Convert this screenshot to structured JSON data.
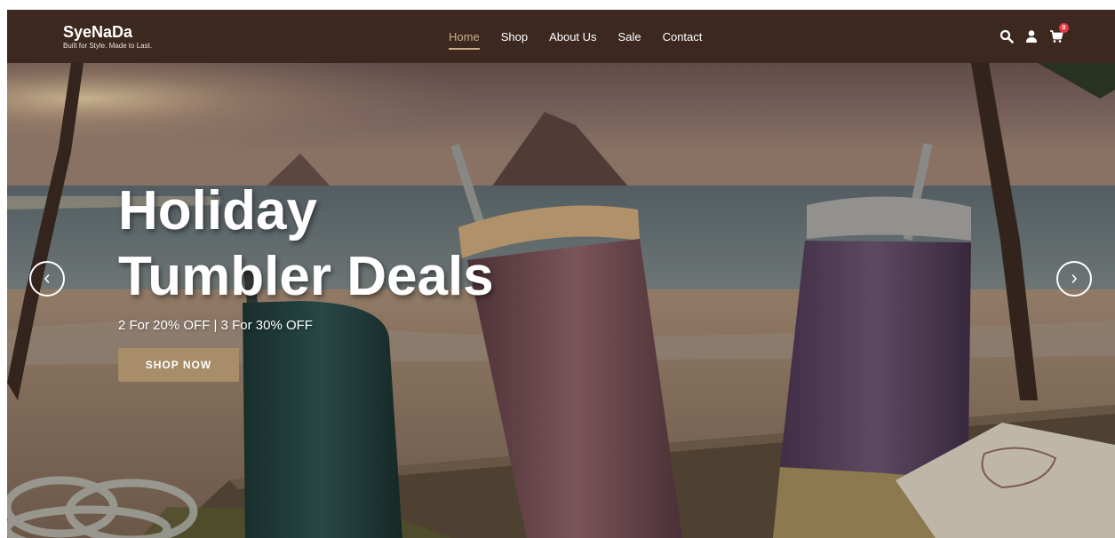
{
  "brand": {
    "name": "SyeNaDa",
    "tagline": "Built for Style. Made to Last."
  },
  "nav": {
    "items": [
      {
        "label": "Home",
        "active": true
      },
      {
        "label": "Shop",
        "active": false
      },
      {
        "label": "About Us",
        "active": false
      },
      {
        "label": "Sale",
        "active": false
      },
      {
        "label": "Contact",
        "active": false
      }
    ]
  },
  "header_icons": {
    "search": "search-icon",
    "account": "user-icon",
    "cart": "cart-icon",
    "cart_count": "0"
  },
  "hero": {
    "title_line1": "Holiday",
    "title_line2": "Tumbler Deals",
    "subtitle": "2 For 20% OFF | 3 For 30% OFF",
    "cta_label": "SHOP NOW",
    "prev_icon": "chevron-left-icon",
    "next_icon": "chevron-right-icon"
  },
  "colors": {
    "header_bg": "#3d2820",
    "nav_active": "#c9ad86",
    "cta_bg": "#a88d69",
    "badge": "#e63946"
  }
}
